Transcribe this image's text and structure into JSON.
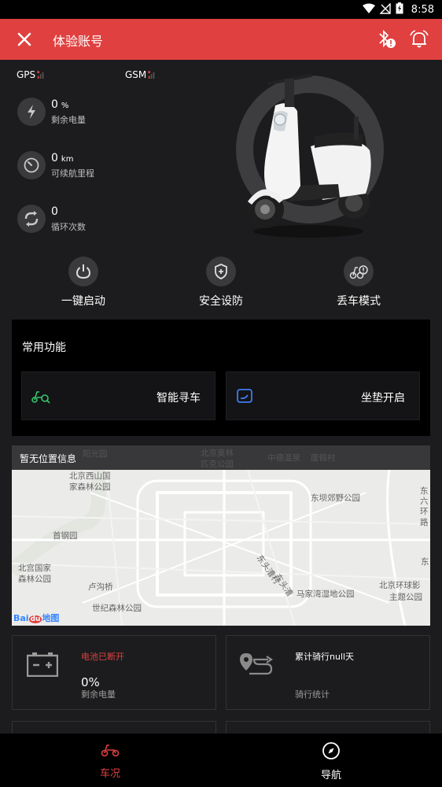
{
  "status_bar": {
    "time": "8:58"
  },
  "app_bar": {
    "title": "体验账号"
  },
  "signals": {
    "gps_label": "GPS",
    "gsm_label": "GSM"
  },
  "stats": [
    {
      "value": "0",
      "unit": "%",
      "label": "剩余电量",
      "icon": "lightning-icon"
    },
    {
      "value": "0",
      "unit": "km",
      "label": "可续航里程",
      "icon": "speedometer-icon"
    },
    {
      "value": "0",
      "unit": "",
      "label": "循环次数",
      "icon": "cycle-icon"
    }
  ],
  "quick_actions": [
    {
      "label": "一键启动",
      "icon": "power-icon"
    },
    {
      "label": "安全设防",
      "icon": "shield-plus-icon"
    },
    {
      "label": "丢车模式",
      "icon": "scooter-alert-icon"
    }
  ],
  "common_functions": {
    "title": "常用功能",
    "items": [
      {
        "label": "智能寻车",
        "icon": "scooter-search-icon",
        "color": "#35c46a"
      },
      {
        "label": "坐垫开启",
        "icon": "seat-icon",
        "color": "#3d7cf0"
      }
    ]
  },
  "map": {
    "header": "暂无位置信息",
    "labels": [
      "北京西山国",
      "家森林公园",
      "东坝郊野公园",
      "东",
      "六",
      "环",
      "路",
      "首钢园",
      "北宫国家",
      "森林公园",
      "卢沟桥",
      "世纪森林公园",
      "东",
      "马家湾湿地公园",
      "北京环球影",
      "主题公园",
      "东头漕村",
      "东头漕"
    ],
    "faded_labels": [
      "阳光园",
      "北京奥林",
      "匹克公园",
      "中德温泉",
      "度假村"
    ],
    "logo": "Bai地图"
  },
  "info_cards": [
    {
      "status": "电池已断开",
      "status_color": "#e0403f",
      "value": "0%",
      "label": "剩余电量",
      "icon": "battery-icon"
    },
    {
      "status": "累计骑行null天",
      "status_color": "#ffffff",
      "label": "骑行统计",
      "icon": "route-icon"
    }
  ],
  "bottom_nav": [
    {
      "label": "车况",
      "icon": "scooter-nav-icon",
      "active": true
    },
    {
      "label": "导航",
      "icon": "compass-icon",
      "active": false
    }
  ],
  "colors": {
    "accent": "#e0403f",
    "background": "#1c1c1e"
  }
}
